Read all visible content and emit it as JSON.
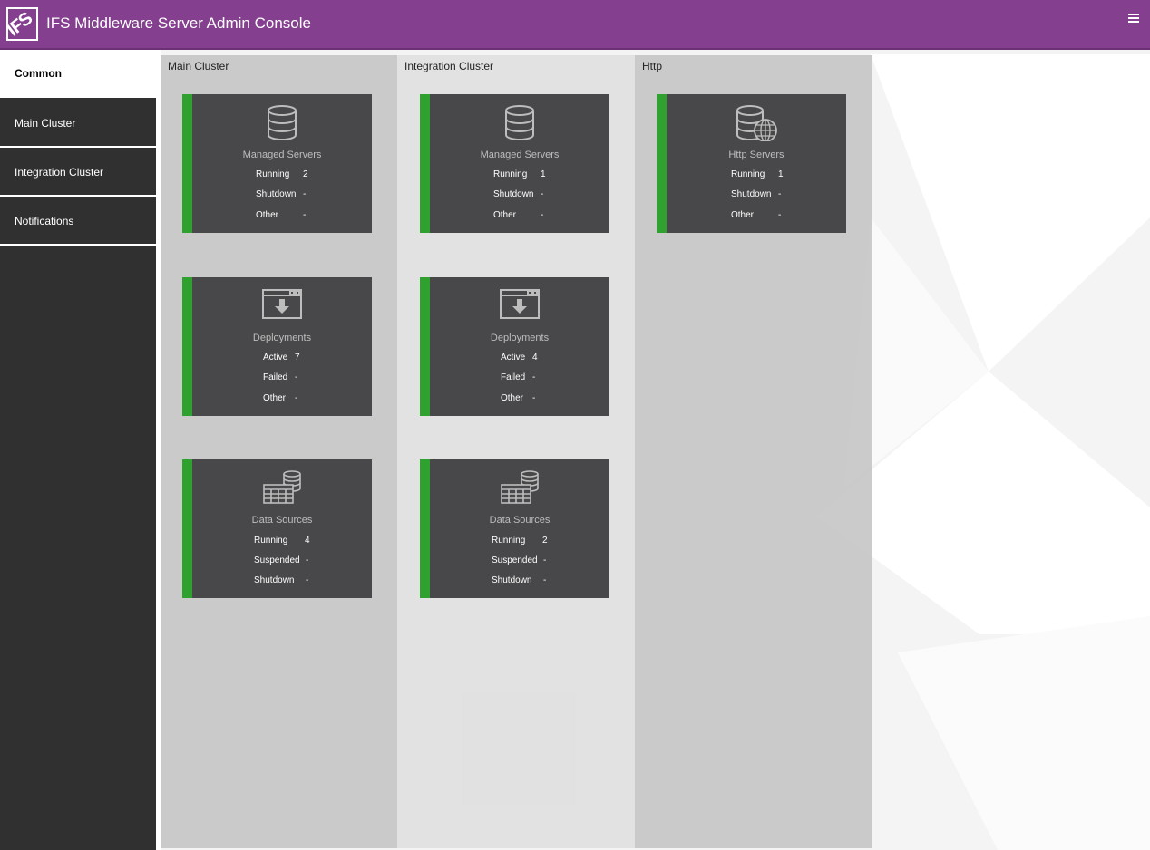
{
  "header": {
    "logo_text": "IFS",
    "title": "IFS Middleware Server Admin Console"
  },
  "sidebar": {
    "items": [
      {
        "label": "Common",
        "active": true
      },
      {
        "label": "Main Cluster",
        "active": false
      },
      {
        "label": "Integration Cluster",
        "active": false
      },
      {
        "label": "Notifications",
        "active": false
      }
    ]
  },
  "columns": [
    {
      "title": "Main Cluster",
      "cards": [
        {
          "title": "Managed Servers",
          "icon": "database-icon",
          "stats": [
            {
              "label": "Running",
              "value": "2"
            },
            {
              "label": "Shutdown",
              "value": "-"
            },
            {
              "label": "Other",
              "value": "-"
            }
          ]
        },
        {
          "title": "Deployments",
          "icon": "download-window-icon",
          "stats": [
            {
              "label": "Active",
              "value": "7"
            },
            {
              "label": "Failed",
              "value": "-"
            },
            {
              "label": "Other",
              "value": "-"
            }
          ]
        },
        {
          "title": "Data Sources",
          "icon": "data-source-icon",
          "stats": [
            {
              "label": "Running",
              "value": "4"
            },
            {
              "label": "Suspended",
              "value": "-"
            },
            {
              "label": "Shutdown",
              "value": "-"
            }
          ]
        }
      ]
    },
    {
      "title": "Integration Cluster",
      "cards": [
        {
          "title": "Managed Servers",
          "icon": "database-icon",
          "stats": [
            {
              "label": "Running",
              "value": "1"
            },
            {
              "label": "Shutdown",
              "value": "-"
            },
            {
              "label": "Other",
              "value": "-"
            }
          ]
        },
        {
          "title": "Deployments",
          "icon": "download-window-icon",
          "stats": [
            {
              "label": "Active",
              "value": "4"
            },
            {
              "label": "Failed",
              "value": "-"
            },
            {
              "label": "Other",
              "value": "-"
            }
          ]
        },
        {
          "title": "Data Sources",
          "icon": "data-source-icon",
          "stats": [
            {
              "label": "Running",
              "value": "2"
            },
            {
              "label": "Suspended",
              "value": "-"
            },
            {
              "label": "Shutdown",
              "value": "-"
            }
          ]
        }
      ]
    },
    {
      "title": "Http",
      "cards": [
        {
          "title": "Http Servers",
          "icon": "database-globe-icon",
          "stats": [
            {
              "label": "Running",
              "value": "1"
            },
            {
              "label": "Shutdown",
              "value": "-"
            },
            {
              "label": "Other",
              "value": "-"
            }
          ]
        }
      ]
    }
  ],
  "colors": {
    "header": "#84408f",
    "sidebar": "#303030",
    "card": "#48484a",
    "status_ok": "#2fa12f"
  }
}
